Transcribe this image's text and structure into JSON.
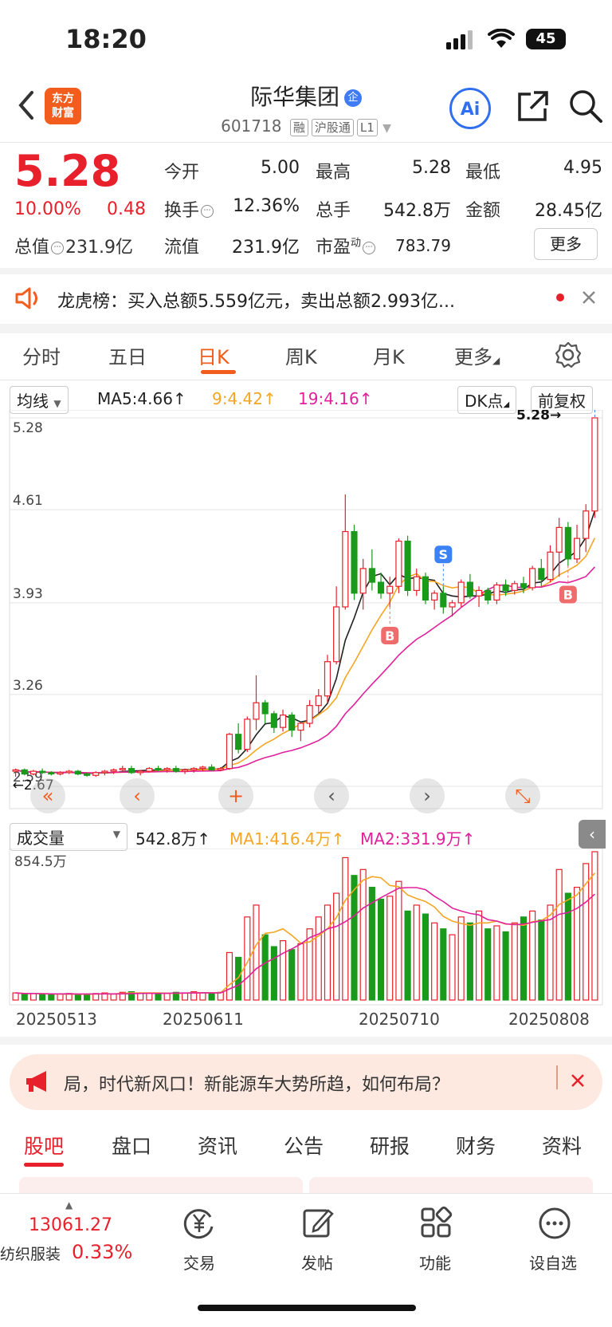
{
  "status_bar": {
    "time": "18:20",
    "battery": "45"
  },
  "header": {
    "logo": "东方财富",
    "name": "际华集团",
    "badge": "企",
    "code": "601718",
    "tags": [
      "融",
      "沪股通",
      "L1"
    ],
    "ai_label": "Ai"
  },
  "quote": {
    "price": "5.28",
    "pct": "10.00%",
    "change": "0.48",
    "rows": [
      [
        {
          "label": "今开",
          "value": "5.00",
          "color": "red"
        },
        {
          "label": "最高",
          "value": "5.28",
          "color": "red"
        },
        {
          "label": "最低",
          "value": "4.95",
          "color": "red"
        }
      ],
      [
        {
          "label": "换手",
          "value": "12.36%",
          "color": "black"
        },
        {
          "label": "总手",
          "value": "542.8万",
          "color": "black"
        },
        {
          "label": "金额",
          "value": "28.45亿",
          "color": "black"
        }
      ]
    ],
    "mktcap_label": "总值",
    "mktcap_value": "231.9亿",
    "float_label": "流值",
    "float_value": "231.9亿",
    "pe_label": "市盈",
    "pe_super": "动",
    "pe_value": "783.79",
    "more": "更多"
  },
  "news": {
    "text": "龙虎榜：买入总额5.559亿元，卖出总额2.993亿..."
  },
  "tabs": [
    "分时",
    "五日",
    "日K",
    "周K",
    "月K",
    "更多"
  ],
  "active_tab": "日K",
  "indicators": {
    "select": "均线",
    "ma5": "MA5:4.66",
    "ma9": "9:4.42",
    "ma19": "19:4.16",
    "dk": "DK点",
    "fq": "前复权",
    "colors": {
      "ma5": "#222222",
      "ma9": "#f5a623",
      "ma19": "#e0219b"
    }
  },
  "chart_data": {
    "type": "candlestick",
    "price_axis_labels": [
      "5.28",
      "4.61",
      "3.93",
      "3.26",
      "2.59"
    ],
    "ylim": [
      2.59,
      5.28
    ],
    "last_price_marker": "5.28→",
    "low_marker": "←2.67",
    "markers": [
      "S",
      "B",
      "B",
      "S"
    ],
    "volume": {
      "select": "成交量",
      "vol": "542.8万",
      "ma1": "MA1:416.4万",
      "ma2": "MA2:331.9万",
      "axis_max": "854.5万"
    },
    "dates": [
      "20250513",
      "20250611",
      "20250710",
      "20250808"
    ],
    "candles": [
      [
        2.7,
        2.72,
        2.66,
        2.71
      ],
      [
        2.71,
        2.72,
        2.67,
        2.68
      ],
      [
        2.68,
        2.71,
        2.67,
        2.7
      ],
      [
        2.7,
        2.72,
        2.68,
        2.69
      ],
      [
        2.69,
        2.7,
        2.67,
        2.68
      ],
      [
        2.68,
        2.7,
        2.67,
        2.69
      ],
      [
        2.69,
        2.71,
        2.68,
        2.7
      ],
      [
        2.7,
        2.71,
        2.67,
        2.68
      ],
      [
        2.68,
        2.69,
        2.66,
        2.67
      ],
      [
        2.67,
        2.7,
        2.66,
        2.69
      ],
      [
        2.69,
        2.71,
        2.67,
        2.7
      ],
      [
        2.7,
        2.72,
        2.68,
        2.71
      ],
      [
        2.71,
        2.74,
        2.69,
        2.72
      ],
      [
        2.72,
        2.74,
        2.68,
        2.69
      ],
      [
        2.69,
        2.71,
        2.67,
        2.7
      ],
      [
        2.7,
        2.73,
        2.69,
        2.72
      ],
      [
        2.72,
        2.74,
        2.7,
        2.71
      ],
      [
        2.71,
        2.73,
        2.69,
        2.72
      ],
      [
        2.72,
        2.74,
        2.69,
        2.7
      ],
      [
        2.7,
        2.72,
        2.68,
        2.71
      ],
      [
        2.71,
        2.73,
        2.69,
        2.72
      ],
      [
        2.72,
        2.74,
        2.7,
        2.73
      ],
      [
        2.73,
        2.75,
        2.7,
        2.71
      ],
      [
        2.71,
        2.73,
        2.7,
        2.72
      ],
      [
        2.72,
        2.98,
        2.71,
        2.97
      ],
      [
        2.97,
        3.05,
        2.83,
        2.86
      ],
      [
        2.86,
        3.1,
        2.84,
        3.08
      ],
      [
        3.08,
        3.4,
        3.0,
        3.2
      ],
      [
        3.2,
        3.22,
        3.05,
        3.12
      ],
      [
        3.12,
        3.14,
        2.98,
        3.02
      ],
      [
        3.02,
        3.15,
        2.99,
        3.11
      ],
      [
        3.11,
        3.13,
        2.95,
        3.0
      ],
      [
        3.0,
        3.06,
        2.92,
        3.05
      ],
      [
        3.05,
        3.22,
        3.02,
        3.18
      ],
      [
        3.18,
        3.3,
        3.12,
        3.25
      ],
      [
        3.25,
        3.55,
        3.2,
        3.5
      ],
      [
        3.5,
        4.05,
        3.48,
        3.9
      ],
      [
        3.9,
        4.72,
        3.88,
        4.45
      ],
      [
        4.45,
        4.5,
        3.95,
        4.0
      ],
      [
        4.0,
        4.25,
        3.88,
        4.18
      ],
      [
        4.18,
        4.32,
        4.02,
        4.08
      ],
      [
        4.08,
        4.15,
        3.96,
        4.0
      ],
      [
        4.0,
        4.12,
        3.9,
        4.05
      ],
      [
        4.05,
        4.4,
        4.0,
        4.38
      ],
      [
        4.38,
        4.42,
        3.98,
        4.02
      ],
      [
        4.02,
        4.18,
        3.98,
        4.12
      ],
      [
        4.12,
        4.15,
        3.92,
        3.95
      ],
      [
        3.95,
        4.02,
        3.88,
        4.0
      ],
      [
        4.0,
        4.05,
        3.85,
        3.9
      ],
      [
        3.9,
        3.95,
        3.83,
        3.93
      ],
      [
        3.93,
        4.1,
        3.9,
        4.08
      ],
      [
        4.08,
        4.14,
        3.96,
        3.98
      ],
      [
        3.98,
        4.05,
        3.9,
        4.02
      ],
      [
        4.02,
        4.04,
        3.92,
        3.95
      ],
      [
        3.95,
        4.08,
        3.92,
        4.06
      ],
      [
        4.06,
        4.1,
        3.98,
        4.02
      ],
      [
        4.02,
        4.09,
        3.99,
        4.07
      ],
      [
        4.07,
        4.12,
        4.0,
        4.04
      ],
      [
        4.04,
        4.2,
        4.02,
        4.18
      ],
      [
        4.18,
        4.25,
        4.05,
        4.1
      ],
      [
        4.1,
        4.35,
        4.08,
        4.3
      ],
      [
        4.3,
        4.55,
        4.12,
        4.48
      ],
      [
        4.48,
        4.52,
        4.2,
        4.25
      ],
      [
        4.25,
        4.5,
        4.22,
        4.4
      ],
      [
        4.4,
        4.65,
        4.3,
        4.6
      ],
      [
        4.6,
        5.28,
        4.55,
        5.28
      ]
    ],
    "volumes": [
      12,
      10,
      11,
      10,
      9,
      10,
      11,
      9,
      10,
      11,
      12,
      10,
      13,
      14,
      11,
      12,
      10,
      11,
      13,
      12,
      14,
      12,
      11,
      13,
      80,
      72,
      140,
      160,
      110,
      90,
      100,
      85,
      95,
      120,
      140,
      160,
      180,
      240,
      210,
      220,
      190,
      170,
      175,
      200,
      150,
      160,
      145,
      130,
      120,
      110,
      140,
      130,
      150,
      120,
      125,
      115,
      130,
      140,
      150,
      135,
      160,
      220,
      180,
      190,
      230,
      250
    ]
  },
  "promo": {
    "text": "局，时代新风口！新能源车大势所趋，如何布局？"
  },
  "bottom_tabs": [
    "股吧",
    "盘口",
    "资讯",
    "公告",
    "研报",
    "财务",
    "资料"
  ],
  "footer": {
    "index_value": "13061.27",
    "index_name": "纺织服装",
    "index_pct": "0.33%",
    "items": [
      "交易",
      "发帖",
      "功能",
      "设自选"
    ]
  }
}
